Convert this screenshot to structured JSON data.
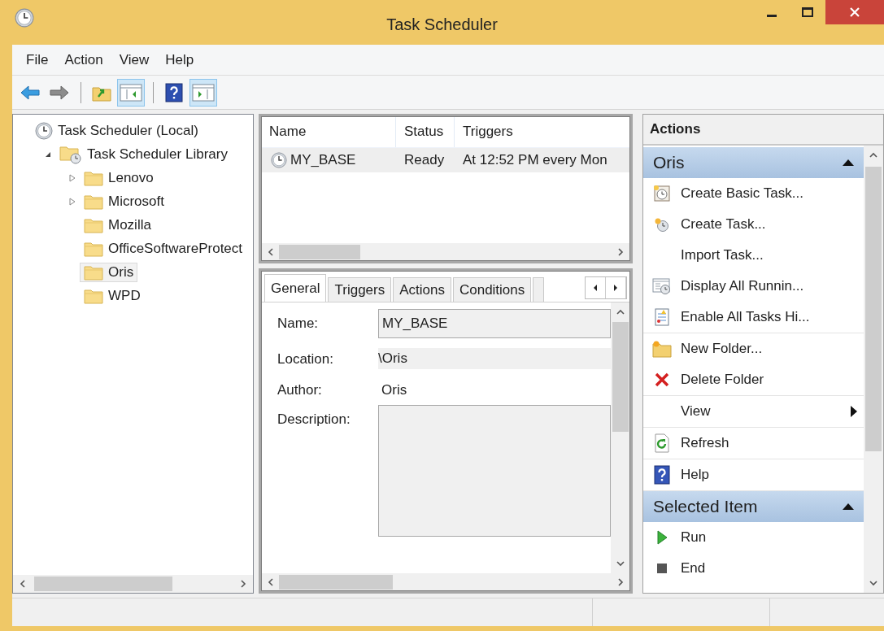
{
  "window": {
    "title": "Task Scheduler"
  },
  "menu": [
    "File",
    "Action",
    "View",
    "Help"
  ],
  "toolbar": [
    [
      {
        "pressed": false
      },
      {
        "pressed": false
      }
    ],
    [
      {
        "pressed": false
      },
      {
        "pressed": true
      }
    ],
    [
      {
        "pressed": false
      },
      {
        "pressed": true
      }
    ]
  ],
  "tree": [
    {
      "label": "Task Scheduler (Local)",
      "selected": false,
      "children": [
        {
          "label": "Task Scheduler Library",
          "expanded": true,
          "selected": false,
          "children": [
            {
              "label": "Lenovo",
              "expanded": false,
              "selected": false
            },
            {
              "label": "Microsoft",
              "expanded": false,
              "selected": false
            },
            {
              "label": "Mozilla",
              "selected": false
            },
            {
              "label": "OfficeSoftwareProtect",
              "selected": false
            },
            {
              "label": "Oris",
              "selected": true
            },
            {
              "label": "WPD",
              "selected": false
            }
          ]
        }
      ]
    }
  ],
  "task_list": {
    "columns": [
      "Name",
      "Status",
      "Triggers"
    ],
    "rows": [
      {
        "cells": [
          "MY_BASE",
          "Ready",
          "At 12:52 PM every Mon"
        ],
        "selected": true
      }
    ]
  },
  "tabs": [
    {
      "label": "General",
      "selected": true
    },
    {
      "label": "Triggers",
      "selected": false
    },
    {
      "label": "Actions",
      "selected": false
    },
    {
      "label": "Conditions",
      "selected": false
    }
  ],
  "general": {
    "fields": [
      {
        "label": "Name:",
        "kind": "input",
        "value": "MY_BASE"
      },
      {
        "label": "Location:",
        "kind": "readonly",
        "value": "\\Oris"
      },
      {
        "label": "Author:",
        "kind": "text",
        "value": "Oris"
      },
      {
        "label": "Description:",
        "kind": "textarea"
      }
    ]
  },
  "actions_pane": {
    "title": "Actions",
    "groups": [
      {
        "title": "Oris",
        "expanded": true,
        "sections": [
          [
            {
              "label": "Create Basic Task...",
              "kind": "command"
            },
            {
              "label": "Create Task...",
              "kind": "command"
            },
            {
              "label": "Import Task...",
              "kind": "command"
            },
            {
              "label": "Display All Runnin...",
              "kind": "command"
            },
            {
              "label": "Enable All Tasks Hi...",
              "kind": "command"
            }
          ],
          [
            {
              "label": "New Folder...",
              "kind": "command"
            },
            {
              "label": "Delete Folder",
              "kind": "command"
            }
          ],
          [
            {
              "label": "View",
              "kind": "submenu"
            }
          ],
          [
            {
              "label": "Refresh",
              "kind": "command"
            }
          ],
          [
            {
              "label": "Help",
              "kind": "command"
            }
          ]
        ]
      },
      {
        "title": "Selected Item",
        "expanded": true,
        "sections": [
          [
            {
              "label": "Run",
              "kind": "command"
            },
            {
              "label": "End",
              "kind": "command"
            }
          ]
        ]
      }
    ]
  }
}
